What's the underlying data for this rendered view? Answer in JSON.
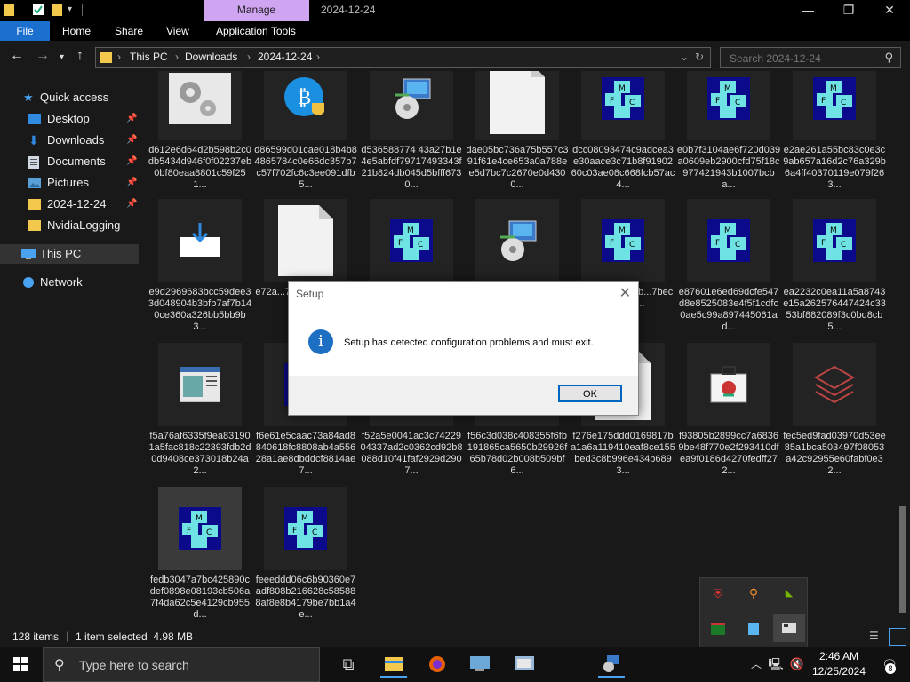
{
  "titlebar": {
    "manage_label": "Manage",
    "window_title": "2024-12-24",
    "minimize": "—",
    "maximize": "❐",
    "close": "✕"
  },
  "ribbon": {
    "tabs": [
      "File",
      "Home",
      "Share",
      "View",
      "Application Tools"
    ]
  },
  "address": {
    "crumbs": [
      "This PC",
      "Downloads",
      "2024-12-24"
    ],
    "search_placeholder": "Search 2024-12-24"
  },
  "nav": {
    "quick_access": "Quick access",
    "items": [
      {
        "label": "Desktop",
        "pinned": true
      },
      {
        "label": "Downloads",
        "pinned": true
      },
      {
        "label": "Documents",
        "pinned": true
      },
      {
        "label": "Pictures",
        "pinned": true
      },
      {
        "label": "2024-12-24",
        "pinned": true
      },
      {
        "label": "NvidiaLogging",
        "pinned": false
      }
    ],
    "this_pc": "This PC",
    "network": "Network"
  },
  "files": [
    {
      "name": "d612e6d64d2b598b2c0db5434d946f0f02237eb0bf80eaa8801c59f251...",
      "icon": "gears-icon"
    },
    {
      "name": "d86599d01cae018b4b84865784c0e66dc357b7c57f702fc6c3ee091dfb5...",
      "icon": "bitcoin-shield-icon"
    },
    {
      "name": "d536588774 43a27b1e4e5abfdf79717493343f21b824db045d5bfff6730...",
      "icon": "installer-icon"
    },
    {
      "name": "dae05bc736a75b557c391f61e4ce653a0a788ee5d7bc7c2670e0d4300...",
      "icon": "blank-file-icon"
    },
    {
      "name": "dcc08093474c9adcea3e30aace3c71b8f9190260c03ae08c668fcb57ac4...",
      "icon": "mfc-icon"
    },
    {
      "name": "e0b7f3104ae6f720d039a0609eb2900cfd75f18c977421943b1007bcba...",
      "icon": "mfc-icon"
    },
    {
      "name": "e2ae261a55bc83c0e3c9ab657a16d2c76a329b6a4ff40370119e079f263...",
      "icon": "mfc-icon"
    },
    {
      "name": "e9d2969683bcc59dee33d048904b3bfb7af7b140ce360a326bb5bb9b3...",
      "icon": "download-tray-icon"
    },
    {
      "name": "e72a...7b59...4054...57e3...",
      "icon": "blank-file-icon"
    },
    {
      "name": "",
      "icon": "mfc-icon"
    },
    {
      "name": "",
      "icon": "installer-icon"
    },
    {
      "name": "...ed401...29a7b...7bec4...32a9...",
      "icon": "mfc-icon"
    },
    {
      "name": "e87601e6ed69dcfe547d8e8525083e4f5f1cdfc0ae5c99a897445061ad...",
      "icon": "mfc-icon"
    },
    {
      "name": "ea2232c0ea11a5a8743e15a262576447424c3353bf882089f3c0bd8cb5...",
      "icon": "mfc-icon"
    },
    {
      "name": "f5a76af6335f9ea831901a5fac818c22393fdb2d0d9408ce373018b24a2...",
      "icon": "window-app-icon"
    },
    {
      "name": "f6e61e5caac73a84ad8840618fc8808ab4a55628a1ae8dbddcf8814ae7...",
      "icon": "mfc-icon"
    },
    {
      "name": "f52a5e0041ac3c7422904337ad2c0362cd92b8088d10f41faf2929d2907...",
      "icon": "mfc-icon"
    },
    {
      "name": "f56c3d038c408355f6fb191865ca5650b29926f65b78d02b008b509bf6...",
      "icon": "mfc-icon"
    },
    {
      "name": "f276e175ddd0169817ba1a6a119410eaf8ce155bed3c8b996e434b6893...",
      "icon": "blank-file-icon"
    },
    {
      "name": "f93805b2899cc7a68369be48f770e2f293410dfea9f0186d4270fedff272...",
      "icon": "briefcase-icon"
    },
    {
      "name": "fec5ed9fad03970d53ee85a1bca503497f08053a42c92955e60fabf0e32...",
      "icon": "layers-icon"
    },
    {
      "name": "fedb3047a7bc425890cdef0898e08193cb506a7f4da62c5e4129cb955d...",
      "icon": "mfc-icon"
    },
    {
      "name": "feeeddd06c6b90360e7adf808b216628c585888af8e8b4179be7bb1a4e...",
      "icon": "mfc-icon"
    }
  ],
  "status": {
    "items": "128 items",
    "selected": "1 item selected  4.98 MB"
  },
  "dialog": {
    "title": "Setup",
    "message": "Setup has detected configuration problems and must exit.",
    "ok": "OK"
  },
  "taskbar": {
    "search_placeholder": "Type here to search",
    "time": "2:46 AM",
    "date": "12/25/2024",
    "notification_count": "8"
  },
  "colors": {
    "manage_tab": "#cfa4f0",
    "file_tab": "#1a6fcf",
    "info_icon": "#1d6fc4"
  }
}
